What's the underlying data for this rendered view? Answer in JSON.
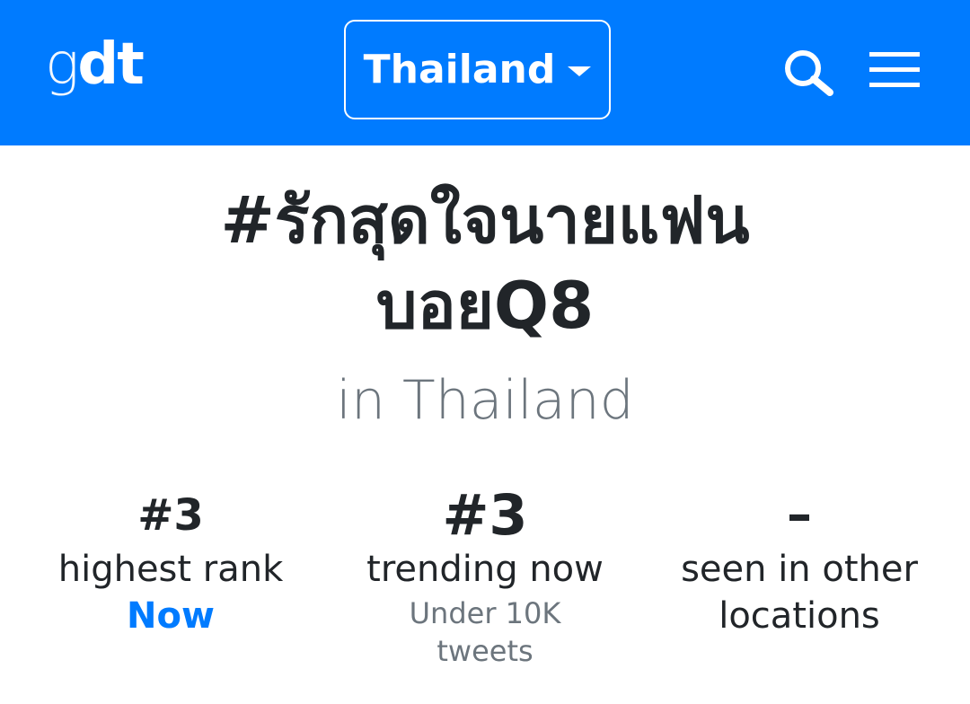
{
  "header": {
    "logo_g": "g",
    "logo_dt": "dt",
    "location": "Thailand",
    "colors": {
      "bar": "#007bff",
      "text": "#ffffff"
    },
    "icons": {
      "search": "search-icon",
      "menu": "hamburger-menu-icon",
      "caret": "caret-down-icon"
    }
  },
  "main": {
    "hashtag_line1": "#รักสุดใจนายแฟน",
    "hashtag_line2": "บอยQ8",
    "subtitle": "in Thailand"
  },
  "stats": [
    {
      "value": "#3",
      "label": "highest rank",
      "detail": "Now"
    },
    {
      "value": "#3",
      "label": "trending now",
      "detail_line1": "Under 10K",
      "detail_line2": "tweets"
    },
    {
      "value": "–",
      "label_line1": "seen in other",
      "label_line2": "locations"
    }
  ]
}
